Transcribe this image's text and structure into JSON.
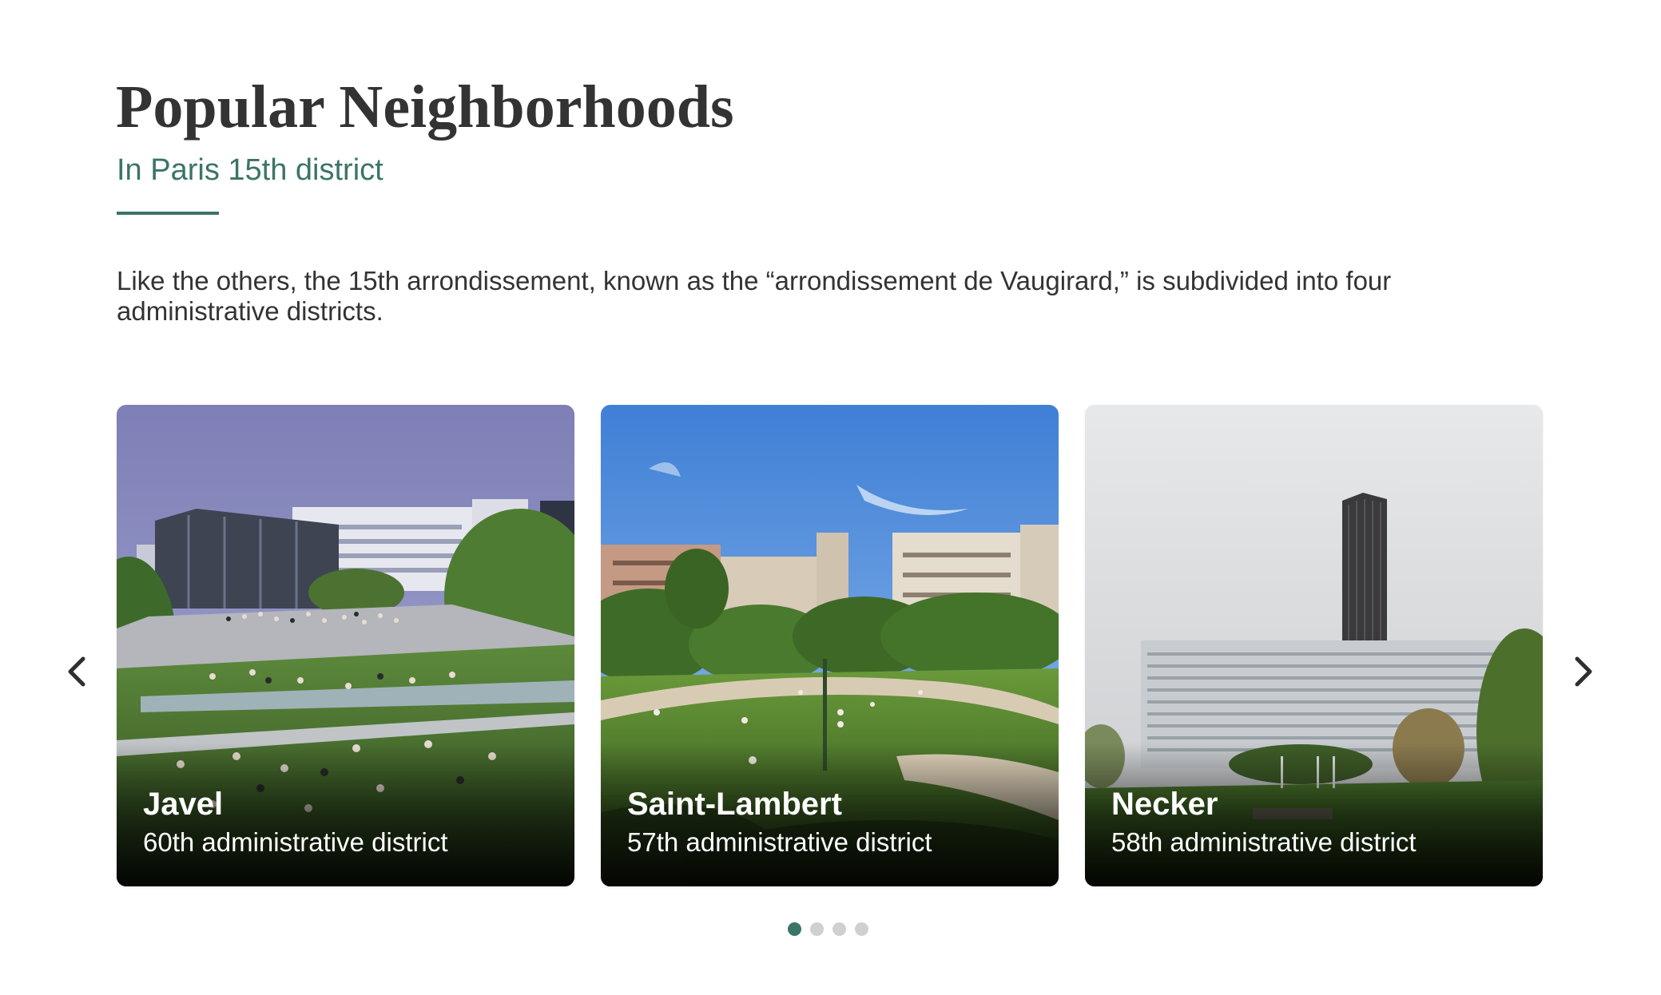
{
  "section": {
    "title": "Popular Neighborhoods",
    "subtitle": "In Paris 15th district",
    "intro": "Like the others, the 15th arrondissement, known as the “arrondissement de Vaugirard,” is subdivided into four administrative districts."
  },
  "carousel": {
    "prev_icon": "chevron-left-icon",
    "next_icon": "chevron-right-icon",
    "cards": [
      {
        "name": "Javel",
        "district": "60th administrative district"
      },
      {
        "name": "Saint-Lambert",
        "district": "57th administrative district"
      },
      {
        "name": "Necker",
        "district": "58th administrative district"
      }
    ],
    "page_count": 4,
    "active_page": 1
  },
  "colors": {
    "accent": "#3b7468",
    "text": "#333333",
    "dot_inactive": "#d0d0d0"
  }
}
